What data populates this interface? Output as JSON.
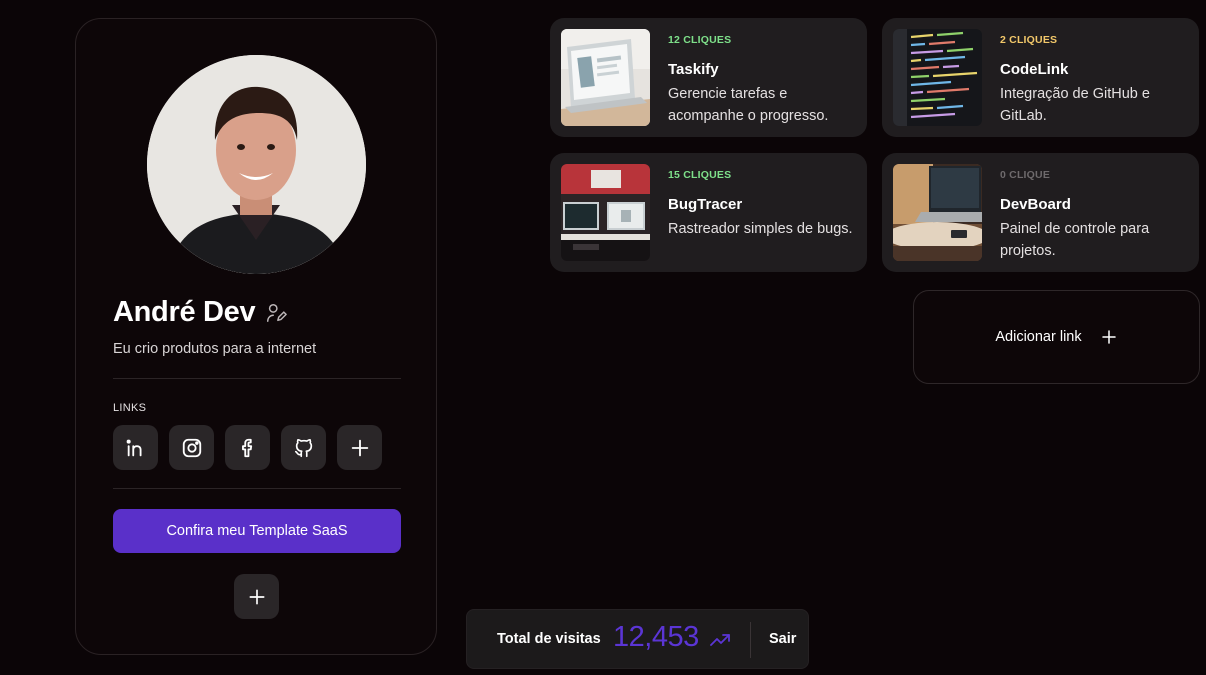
{
  "profile": {
    "name": "André Dev",
    "bio": "Eu crio produtos para a internet",
    "links_label": "LINKS",
    "social": [
      {
        "icon": "linkedin-icon"
      },
      {
        "icon": "instagram-icon"
      },
      {
        "icon": "facebook-icon"
      },
      {
        "icon": "github-icon"
      },
      {
        "icon": "plus-icon"
      }
    ],
    "cta_label": "Confira meu Template SaaS"
  },
  "links": [
    {
      "clicks": "12 CLIQUES",
      "clicks_color": "#7ee08a",
      "title": "Taskify",
      "description": "Gerencie tarefas e acompanhe o progresso."
    },
    {
      "clicks": "2 CLIQUES",
      "clicks_color": "#f2c86a",
      "title": "CodeLink",
      "description": "Integração de GitHub e GitLab."
    },
    {
      "clicks": "15 CLIQUES",
      "clicks_color": "#7ee08a",
      "title": "BugTracer",
      "description": "Rastreador simples de bugs."
    },
    {
      "clicks": "0 CLIQUE",
      "clicks_color": "#6e6a6c",
      "title": "DevBoard",
      "description": "Painel de controle para projetos."
    }
  ],
  "add_link_label": "Adicionar link",
  "stats": {
    "label": "Total de visitas",
    "value": "12,453",
    "value_color": "#5b35d5",
    "logout_label": "Sair"
  },
  "colors": {
    "accent": "#5a30c9",
    "background": "#0b0507",
    "card": "#201d1f"
  }
}
